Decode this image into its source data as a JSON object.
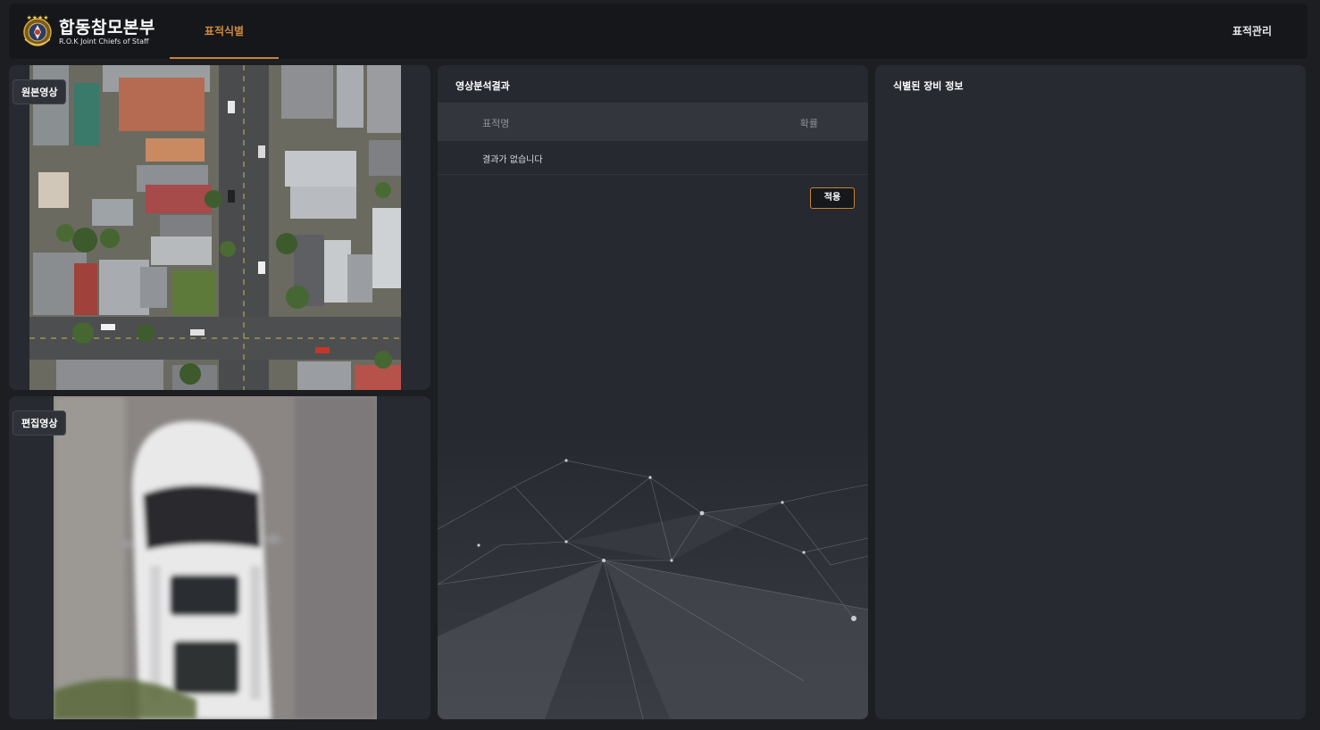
{
  "header": {
    "logo": {
      "title": "합동참모본부",
      "subtitle": "R.O.K Joint Chiefs of Staff",
      "emblem_icon": "jcs-emblem-icon"
    },
    "nav": {
      "active_tab": "표적식별",
      "right_tab": "표적관리"
    },
    "colors": {
      "accent": "#c98333",
      "bg": "#15171b"
    }
  },
  "original_video": {
    "label": "원본영상",
    "content": "aerial-city-image"
  },
  "edited_video": {
    "label": "편집영상",
    "content": "zoomed-white-vehicle-image"
  },
  "analysis": {
    "title": "영상분석결과",
    "columns": [
      "표적명",
      "확률"
    ],
    "empty_text": "결과가 없습니다",
    "apply_label": "적용"
  },
  "equipment": {
    "title": "식별된 장비 정보"
  }
}
